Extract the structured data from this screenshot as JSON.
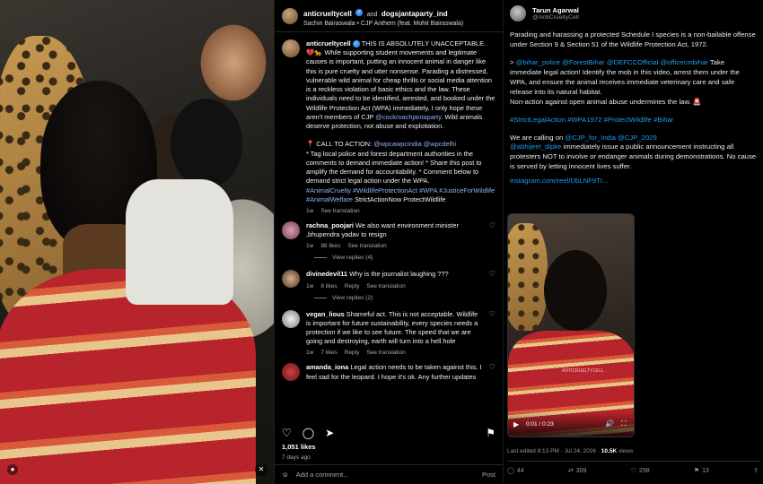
{
  "video": {
    "mute_icon": "speaker-muted-icon",
    "profile_icon": "person-icon"
  },
  "instagram": {
    "header": {
      "user1": "anticrueltycell",
      "joiner": "and",
      "user2": "dogsjantaparty_ind",
      "audio": "Sachin Bairaswala • CJP Anthem (feat. Mohit Bairaswala)"
    },
    "caption": {
      "user": "anticrueltycell",
      "p1": "THIS IS ABSOLUTELY UNACCEPTABLE. 💔🐆 While supporting student movements and legitimate causes is important, putting an innocent animal in danger like this is pure cruelty and utter nonsense. Parading a distressed, vulnerable wild animal for cheap thrills or social media attention is a reckless violation of basic ethics and the law. These individuals need to be identified, arrested, and booked under the Wildlife Protection Act (WPA) immediately. I only hope these aren't members of CJP",
      "p1_tag": "@cockroachjantaparty",
      "p1_end": ". Wild animals deserve protection, not abuse and exploitation.",
      "cta_head": "📍 CALL TO ACTION:",
      "cta_tags": "@wpcawpcindia @wpcdelhi",
      "cta_lines": "* Tag local police and forest department authorities in the comments to demand immediate action! * Share this post to amplify the demand for accountability. * Comment below to demand strict legal action under the WPA.",
      "hashtags": "#AnimalCruelty #WildlifeProtectionAct #WPA #JusticeForWildlife #AnimalWelfare",
      "hashtags_end": "StrictActionNow ProtectWildlife",
      "meta_time": "1w",
      "meta_action": "See translation"
    },
    "comments": [
      {
        "user": "rachna_poojari",
        "text": "We also want environment minister ,bhupendra yadav to resign",
        "time": "1w",
        "likes": "98 likes",
        "reply": "",
        "translate": "See translation",
        "replies": "View replies (4)"
      },
      {
        "user": "divinedevil11",
        "text": "Why is the journalist laughing ???",
        "time": "1w",
        "likes": "8 likes",
        "reply": "Reply",
        "translate": "See translation",
        "replies": "View replies (2)"
      },
      {
        "user": "vegan_lious",
        "text": "Shameful act. This is not acceptable. Wildlife is important for future sustainability, every species needs a protection if we like to see future. The speed that we are going and destroying, earth will turn into a hell hole",
        "time": "1w",
        "likes": "7 likes",
        "reply": "Reply",
        "translate": "See translation",
        "replies": ""
      },
      {
        "user": "amanda_iona",
        "text": "Legal action needs to be taken against this. I feel sad for the leopard. I hope it's ok. Any further updates",
        "time": "",
        "likes": "",
        "reply": "",
        "translate": "",
        "replies": ""
      }
    ],
    "likes": "1,051 likes",
    "time_ago": "7 days ago",
    "add_comment": "Add a comment...",
    "post_label": "Post"
  },
  "x_post": {
    "name": "Tarun Agarwal",
    "handle": "@AntiCrueltyCell",
    "p1": "Parading and harassing a protected Schedule I species is a non-bailable offense under Section 9 & Section 51 of the Wildlife Protection Act, 1972.",
    "p2_prefix": ">",
    "p2_tags": "@bihar_police @ForestBihar @DEFCCOfficial @officecmbihar",
    "p2_text": "Take immediate legal action! Identify the mob in this video, arrest them under the WPA, and ensure the animal receives immediate veterinary care and safe release into its natural habitat.",
    "p2_end": "Non-action against open animal abuse undermines the law. 🚨",
    "hashtags": "#StrictLegalAction #WPA1972 #ProtectWildlife #Bihar",
    "p3_a": "We are calling on",
    "p3_tags": "@CJP_for_India @CJP_2029",
    "p3_tag2": "@abhijeet_dipke",
    "p3_b": "immediately issue a public announcement instructing all protesters NOT to involve or endanger animals during demonstrations. No cause is served by letting innocent lives suffer.",
    "link": "instagram.com/reel/DbLNF9TI...",
    "media_time": "0:01 / 0:23",
    "media_watermark": "ANTICRUELTYCELL",
    "last_edited": "Last edited 8:13 PM · Jul 24, 2026 ·",
    "views_count": "10.5K",
    "views_label": "views",
    "replies": "44",
    "reposts": "309",
    "likes": "298",
    "bookmarks": "13"
  }
}
